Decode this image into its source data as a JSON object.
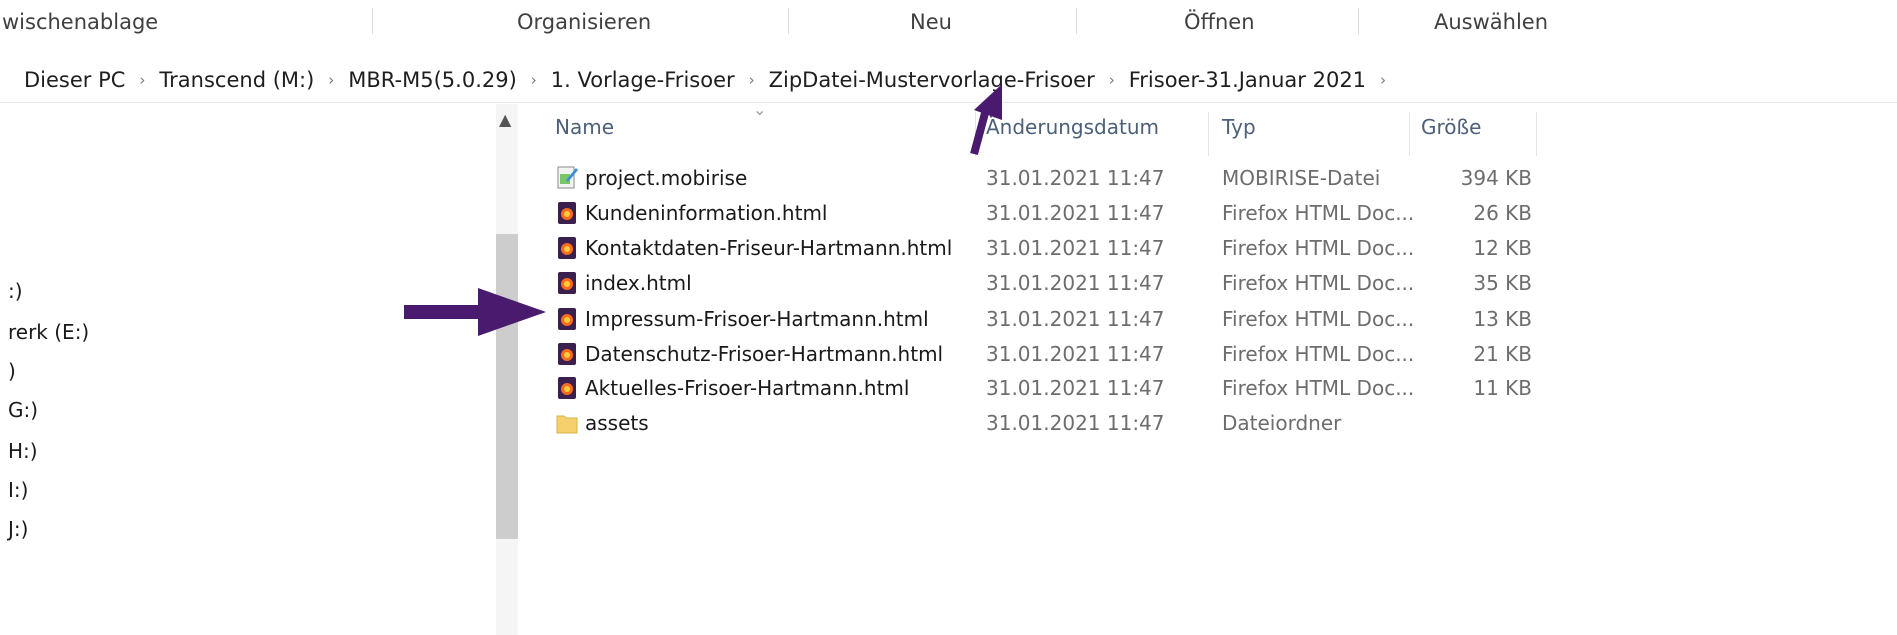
{
  "ribbon": {
    "groups": [
      "wischenablage",
      "Organisieren",
      "Neu",
      "Öffnen",
      "Auswählen"
    ]
  },
  "breadcrumb": {
    "items": [
      "Dieser PC",
      "Transcend (M:)",
      "MBR-M5(5.0.29)",
      "1. Vorlage-Frisoer",
      "ZipDatei-Mustervorlage-Frisoer",
      "Frisoer-31.Januar 2021"
    ],
    "separator": "›"
  },
  "nav": {
    "items": [
      ":)",
      "rerk (E:)",
      ")",
      "G:)",
      "H:)",
      "I:)",
      "J:)"
    ]
  },
  "columns": {
    "name": "Name",
    "date": "Änderungsdatum",
    "type": "Typ",
    "size": "Größe"
  },
  "files": [
    {
      "name": "project.mobirise",
      "date": "31.01.2021 11:47",
      "type": "MOBIRISE-Datei",
      "size": "394 KB",
      "icon": "mobirise-file-icon"
    },
    {
      "name": "Kundeninformation.html",
      "date": "31.01.2021 11:47",
      "type": "Firefox HTML Doc...",
      "size": "26 KB",
      "icon": "firefox-html-icon"
    },
    {
      "name": "Kontaktdaten-Friseur-Hartmann.html",
      "date": "31.01.2021 11:47",
      "type": "Firefox HTML Doc...",
      "size": "12 KB",
      "icon": "firefox-html-icon"
    },
    {
      "name": "index.html",
      "date": "31.01.2021 11:47",
      "type": "Firefox HTML Doc...",
      "size": "35 KB",
      "icon": "firefox-html-icon"
    },
    {
      "name": "Impressum-Frisoer-Hartmann.html",
      "date": "31.01.2021 11:47",
      "type": "Firefox HTML Doc...",
      "size": "13 KB",
      "icon": "firefox-html-icon"
    },
    {
      "name": "Datenschutz-Frisoer-Hartmann.html",
      "date": "31.01.2021 11:47",
      "type": "Firefox HTML Doc...",
      "size": "21 KB",
      "icon": "firefox-html-icon"
    },
    {
      "name": "Aktuelles-Frisoer-Hartmann.html",
      "date": "31.01.2021 11:47",
      "type": "Firefox HTML Doc...",
      "size": "11 KB",
      "icon": "firefox-html-icon"
    },
    {
      "name": "assets",
      "date": "31.01.2021 11:47",
      "type": "Dateiordner",
      "size": "",
      "icon": "folder-icon"
    }
  ],
  "colors": {
    "annotation_arrow": "#4a1a6e",
    "header_text": "#4c607a",
    "folder": "#f5d06c"
  }
}
